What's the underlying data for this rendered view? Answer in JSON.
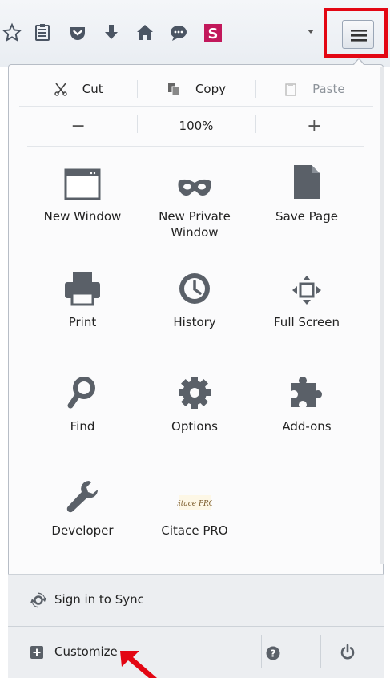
{
  "toolbar": {
    "icons": [
      "star-icon",
      "reading-list-icon",
      "pocket-icon",
      "downloads-icon",
      "home-icon",
      "chat-icon",
      "s-extension-icon",
      "dropdown-icon",
      "hamburger-menu-icon"
    ],
    "accent": "#e30613"
  },
  "edit": {
    "cut": "Cut",
    "copy": "Copy",
    "paste": "Paste"
  },
  "zoom": {
    "minus": "−",
    "value": "100%",
    "plus": "+"
  },
  "items": {
    "new_window": "New Window",
    "new_private_window": "New Private\nWindow",
    "save_page": "Save Page",
    "print": "Print",
    "history": "History",
    "full_screen": "Full Screen",
    "find": "Find",
    "options": "Options",
    "addons": "Add-ons",
    "developer": "Developer",
    "citace": "Citace PRO",
    "citace_logo": "citace PRO"
  },
  "footer": {
    "sync": "Sign in to Sync",
    "customize": "Customize"
  }
}
